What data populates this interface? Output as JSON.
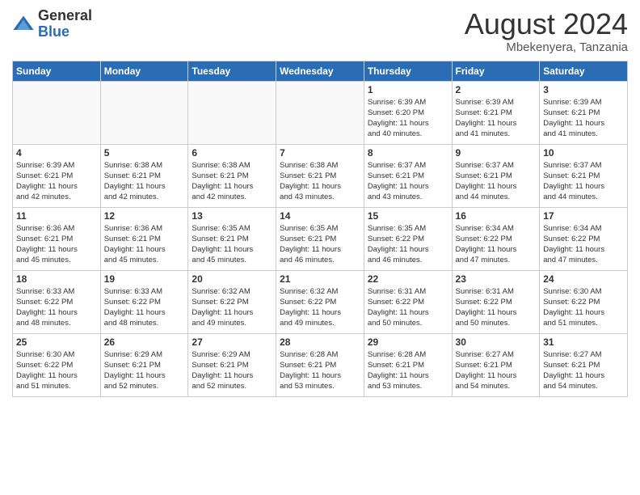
{
  "header": {
    "logo_general": "General",
    "logo_blue": "Blue",
    "month_title": "August 2024",
    "subtitle": "Mbekenyera, Tanzania"
  },
  "days_of_week": [
    "Sunday",
    "Monday",
    "Tuesday",
    "Wednesday",
    "Thursday",
    "Friday",
    "Saturday"
  ],
  "weeks": [
    [
      {
        "day": "",
        "info": ""
      },
      {
        "day": "",
        "info": ""
      },
      {
        "day": "",
        "info": ""
      },
      {
        "day": "",
        "info": ""
      },
      {
        "day": "1",
        "info": "Sunrise: 6:39 AM\nSunset: 6:20 PM\nDaylight: 11 hours\nand 40 minutes."
      },
      {
        "day": "2",
        "info": "Sunrise: 6:39 AM\nSunset: 6:21 PM\nDaylight: 11 hours\nand 41 minutes."
      },
      {
        "day": "3",
        "info": "Sunrise: 6:39 AM\nSunset: 6:21 PM\nDaylight: 11 hours\nand 41 minutes."
      }
    ],
    [
      {
        "day": "4",
        "info": "Sunrise: 6:39 AM\nSunset: 6:21 PM\nDaylight: 11 hours\nand 42 minutes."
      },
      {
        "day": "5",
        "info": "Sunrise: 6:38 AM\nSunset: 6:21 PM\nDaylight: 11 hours\nand 42 minutes."
      },
      {
        "day": "6",
        "info": "Sunrise: 6:38 AM\nSunset: 6:21 PM\nDaylight: 11 hours\nand 42 minutes."
      },
      {
        "day": "7",
        "info": "Sunrise: 6:38 AM\nSunset: 6:21 PM\nDaylight: 11 hours\nand 43 minutes."
      },
      {
        "day": "8",
        "info": "Sunrise: 6:37 AM\nSunset: 6:21 PM\nDaylight: 11 hours\nand 43 minutes."
      },
      {
        "day": "9",
        "info": "Sunrise: 6:37 AM\nSunset: 6:21 PM\nDaylight: 11 hours\nand 44 minutes."
      },
      {
        "day": "10",
        "info": "Sunrise: 6:37 AM\nSunset: 6:21 PM\nDaylight: 11 hours\nand 44 minutes."
      }
    ],
    [
      {
        "day": "11",
        "info": "Sunrise: 6:36 AM\nSunset: 6:21 PM\nDaylight: 11 hours\nand 45 minutes."
      },
      {
        "day": "12",
        "info": "Sunrise: 6:36 AM\nSunset: 6:21 PM\nDaylight: 11 hours\nand 45 minutes."
      },
      {
        "day": "13",
        "info": "Sunrise: 6:35 AM\nSunset: 6:21 PM\nDaylight: 11 hours\nand 45 minutes."
      },
      {
        "day": "14",
        "info": "Sunrise: 6:35 AM\nSunset: 6:21 PM\nDaylight: 11 hours\nand 46 minutes."
      },
      {
        "day": "15",
        "info": "Sunrise: 6:35 AM\nSunset: 6:22 PM\nDaylight: 11 hours\nand 46 minutes."
      },
      {
        "day": "16",
        "info": "Sunrise: 6:34 AM\nSunset: 6:22 PM\nDaylight: 11 hours\nand 47 minutes."
      },
      {
        "day": "17",
        "info": "Sunrise: 6:34 AM\nSunset: 6:22 PM\nDaylight: 11 hours\nand 47 minutes."
      }
    ],
    [
      {
        "day": "18",
        "info": "Sunrise: 6:33 AM\nSunset: 6:22 PM\nDaylight: 11 hours\nand 48 minutes."
      },
      {
        "day": "19",
        "info": "Sunrise: 6:33 AM\nSunset: 6:22 PM\nDaylight: 11 hours\nand 48 minutes."
      },
      {
        "day": "20",
        "info": "Sunrise: 6:32 AM\nSunset: 6:22 PM\nDaylight: 11 hours\nand 49 minutes."
      },
      {
        "day": "21",
        "info": "Sunrise: 6:32 AM\nSunset: 6:22 PM\nDaylight: 11 hours\nand 49 minutes."
      },
      {
        "day": "22",
        "info": "Sunrise: 6:31 AM\nSunset: 6:22 PM\nDaylight: 11 hours\nand 50 minutes."
      },
      {
        "day": "23",
        "info": "Sunrise: 6:31 AM\nSunset: 6:22 PM\nDaylight: 11 hours\nand 50 minutes."
      },
      {
        "day": "24",
        "info": "Sunrise: 6:30 AM\nSunset: 6:22 PM\nDaylight: 11 hours\nand 51 minutes."
      }
    ],
    [
      {
        "day": "25",
        "info": "Sunrise: 6:30 AM\nSunset: 6:22 PM\nDaylight: 11 hours\nand 51 minutes."
      },
      {
        "day": "26",
        "info": "Sunrise: 6:29 AM\nSunset: 6:21 PM\nDaylight: 11 hours\nand 52 minutes."
      },
      {
        "day": "27",
        "info": "Sunrise: 6:29 AM\nSunset: 6:21 PM\nDaylight: 11 hours\nand 52 minutes."
      },
      {
        "day": "28",
        "info": "Sunrise: 6:28 AM\nSunset: 6:21 PM\nDaylight: 11 hours\nand 53 minutes."
      },
      {
        "day": "29",
        "info": "Sunrise: 6:28 AM\nSunset: 6:21 PM\nDaylight: 11 hours\nand 53 minutes."
      },
      {
        "day": "30",
        "info": "Sunrise: 6:27 AM\nSunset: 6:21 PM\nDaylight: 11 hours\nand 54 minutes."
      },
      {
        "day": "31",
        "info": "Sunrise: 6:27 AM\nSunset: 6:21 PM\nDaylight: 11 hours\nand 54 minutes."
      }
    ]
  ]
}
